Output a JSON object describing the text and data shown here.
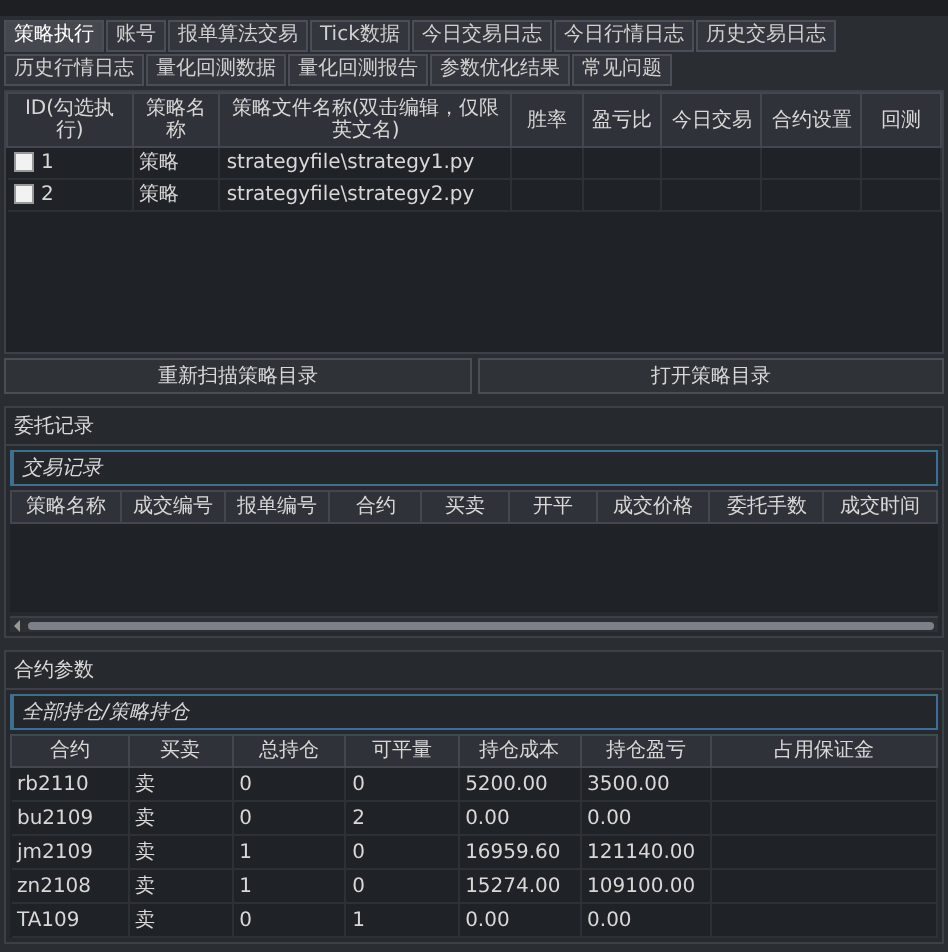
{
  "tabs": [
    {
      "label": "策略执行",
      "selected": true
    },
    {
      "label": "账号",
      "selected": false
    },
    {
      "label": "报单算法交易",
      "selected": false
    },
    {
      "label": "Tick数据",
      "selected": false
    },
    {
      "label": "今日交易日志",
      "selected": false
    },
    {
      "label": "今日行情日志",
      "selected": false
    },
    {
      "label": "历史交易日志",
      "selected": false
    },
    {
      "label": "历史行情日志",
      "selected": false
    },
    {
      "label": "量化回测数据",
      "selected": false
    },
    {
      "label": "量化回测报告",
      "selected": false
    },
    {
      "label": "参数优化结果",
      "selected": false
    },
    {
      "label": "常见问题",
      "selected": false
    }
  ],
  "strategy_table": {
    "columns": [
      "ID(勾选执行)",
      "策略名称",
      "策略文件名称(双击编辑，仅限英文名)",
      "胜率",
      "盈亏比",
      "今日交易",
      "合约设置",
      "回测"
    ],
    "rows": [
      {
        "checked": false,
        "cells": [
          "1",
          "策略",
          "strategyfile\\strategy1.py"
        ]
      },
      {
        "checked": false,
        "cells": [
          "2",
          "策略",
          "strategyfile\\strategy2.py"
        ]
      }
    ]
  },
  "buttons": [
    "重新扫描策略目录",
    "打开策略目录"
  ],
  "orders": {
    "title": "委托记录",
    "subtab": "交易记录",
    "columns": [
      "策略名称",
      "成交编号",
      "报单编号",
      "合约",
      "买卖",
      "开平",
      "成交价格",
      "委托手数",
      "成交时间"
    ]
  },
  "positions": {
    "title": "合约参数",
    "subtab": "全部持仓/策略持仓",
    "columns": [
      "合约",
      "买卖",
      "总持仓",
      "可平量",
      "持仓成本",
      "持仓盈亏",
      "占用保证金"
    ],
    "rows": [
      [
        "rb2110",
        "卖",
        "0",
        "0",
        "5200.00",
        "3500.00"
      ],
      [
        "bu2109",
        "卖",
        "0",
        "2",
        "0.00",
        "0.00"
      ],
      [
        "jm2109",
        "卖",
        "1",
        "0",
        "16959.60",
        "121140.00"
      ],
      [
        "zn2108",
        "卖",
        "1",
        "0",
        "15274.00",
        "109100.00"
      ],
      [
        "TA109",
        "卖",
        "0",
        "1",
        "0.00",
        "0.00"
      ]
    ]
  }
}
